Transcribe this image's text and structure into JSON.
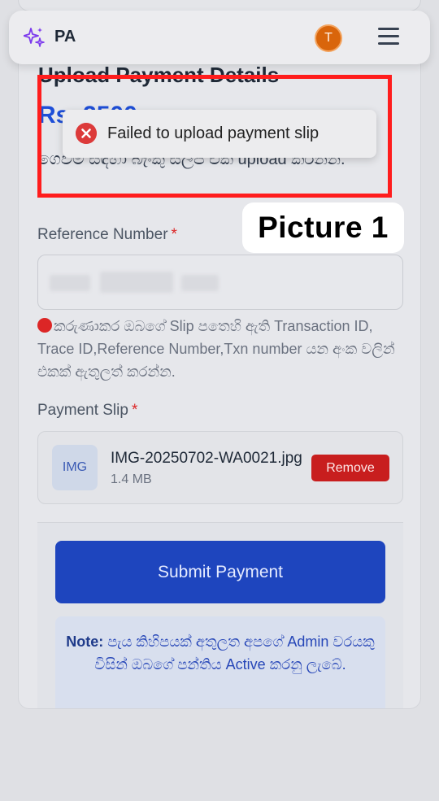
{
  "header": {
    "app_name": "PA",
    "avatar_initial": "T",
    "logo_icon": "sparkle-icon",
    "menu_icon": "hamburger-menu-icon"
  },
  "page": {
    "title": "Upload Payment Details",
    "amount": "Rs. 2500",
    "instruction": "ගෙවීම් සඳහා බැංකු ස්ලිප් එක upload කරන්න."
  },
  "toast": {
    "message": "Failed to upload payment slip",
    "icon": "error-circle-icon"
  },
  "reference": {
    "label": "Reference Number",
    "required_mark": "*",
    "hint": "කරුණාකර ඔබගේ Slip පතෙහි ඇති Transaction ID, Trace ID,Reference Number,Txn number යන අංක වලින් එකක් ඇතුලත් කරන්න."
  },
  "payment_slip": {
    "label": "Payment Slip",
    "required_mark": "*",
    "thumb_label": "IMG",
    "file_name": "IMG-20250702-WA0021.jpg",
    "file_size": "1.4 MB",
    "remove_label": "Remove"
  },
  "submit": {
    "label": "Submit Payment"
  },
  "note": {
    "heading": "Note:",
    "text": "පැය කිහිපයක් අතුලත අපගේ Admin වරයකු විසින් ඔබගේ පන්තිය Active කරනු ලැබේ."
  },
  "annotation": {
    "label": "Picture 1"
  },
  "colors": {
    "accent": "#1e45be",
    "error": "#dc2626",
    "avatar": "#d9650b",
    "frame": "#ff1d1d"
  }
}
